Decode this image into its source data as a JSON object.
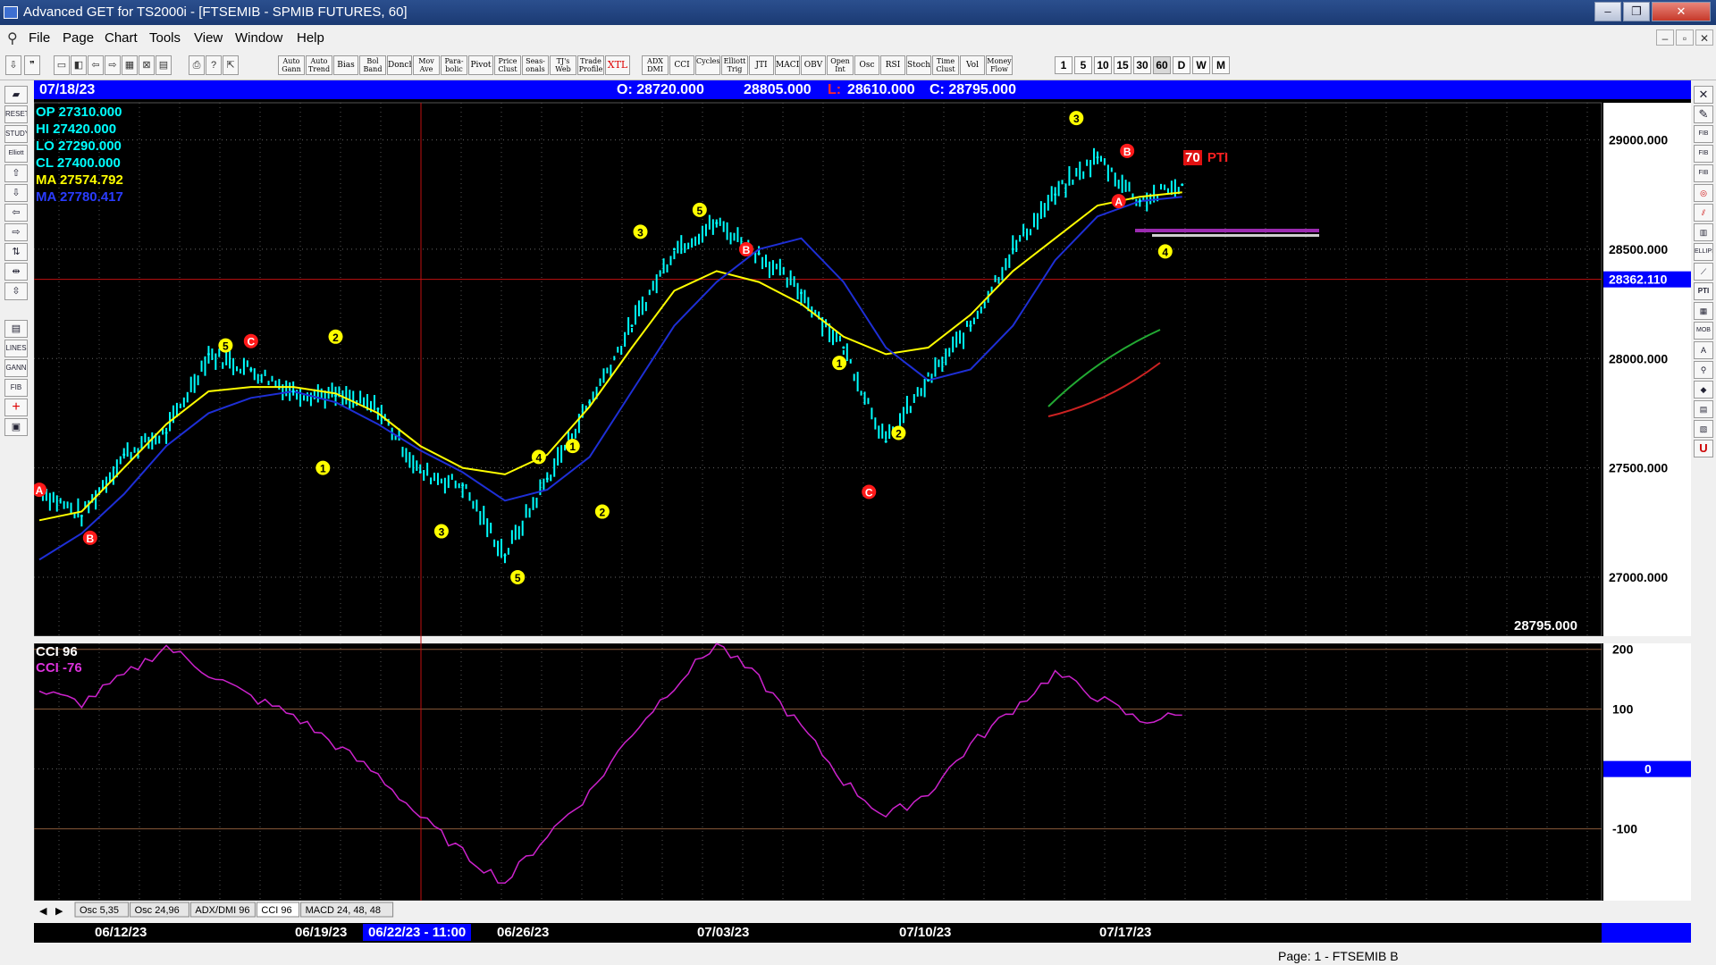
{
  "window": {
    "title": "Advanced GET for TS2000i - [FTSEMIB - SPMIB FUTURES, 60]",
    "controls": [
      "‒",
      "❐",
      "✕"
    ]
  },
  "menu": [
    "File",
    "Page",
    "Chart",
    "Tools",
    "View",
    "Window",
    "Help"
  ],
  "mdi_controls": [
    "‒",
    "▫",
    "✕"
  ],
  "toolbar": {
    "studies": [
      "Auto Gann",
      "Auto Trend",
      "Bias",
      "Bol Band",
      "Donch",
      "Mov Ave",
      "Para-bolic",
      "Pivot",
      "Price Clust",
      "Seas-onals",
      "TJ's Web",
      "Trade Profile",
      "XTL",
      "ADX DMI",
      "CCI",
      "Cycles",
      "Elliott Trig",
      "JTI",
      "MACD",
      "OBV",
      "Open Int",
      "Osc",
      "RSI",
      "Stoch",
      "Time Clust",
      "Vol",
      "Money Flow"
    ],
    "timeframes": [
      "1",
      "5",
      "10",
      "15",
      "30",
      "60",
      "D",
      "W",
      "M"
    ],
    "active_timeframe": "60"
  },
  "left_toolbar": [
    "RESET",
    "STUDY",
    "Elliott",
    "LINES",
    "GANN",
    "FIB"
  ],
  "right_toolbar": [
    "FIB RET",
    "FIB EXT",
    "FIB TIME",
    "ELLIPS",
    "PTI",
    "MOB"
  ],
  "infobar": {
    "date": "07/18/23",
    "open": "O: 28720.000",
    "high": "28805.000",
    "low_label": "L:",
    "low": "28610.000",
    "close": "C: 28795.000"
  },
  "readout": {
    "op": "OP  27310.000",
    "hi": "HI   27420.000",
    "lo": "LO  27290.000",
    "cl": "CL  27400.000",
    "ma1": "MA  27574.792",
    "ma2": "MA  27780.417"
  },
  "price_axis": {
    "ticks": [
      "29000.000",
      "28500.000",
      "28000.000",
      "27500.000",
      "27000.000"
    ],
    "tick_values": [
      29000,
      28500,
      28000,
      27500,
      27000
    ],
    "cursor_price": "28362.110",
    "last_price": "28795.000",
    "range": [
      26730,
      29170
    ]
  },
  "cci_panel": {
    "label1": "CCI 96",
    "label2": "CCI  -76",
    "ticks": [
      "200",
      "100",
      "0",
      "-100"
    ],
    "tick_values": [
      200,
      100,
      0,
      -100
    ],
    "highlight": "0",
    "range": [
      -220,
      210
    ]
  },
  "pti": {
    "value": "70",
    "label": "PTI"
  },
  "tabs": [
    "Osc 5,35",
    "Osc 24,96",
    "ADX/DMI 96",
    "CCI 96",
    "MACD 24, 48, 48"
  ],
  "active_tab": "CCI 96",
  "date_axis": {
    "labels": [
      "06/12/23",
      "06/19/23",
      "06/26/23",
      "07/03/23",
      "07/10/23",
      "07/17/23"
    ],
    "cursor_date": "06/22/23 - 11:00"
  },
  "status": {
    "page": "Page: 1 - FTSEMIB B"
  },
  "colors": {
    "ma_fast": "#ffff00",
    "ma_slow": "#1e2fd6",
    "price_bars": "#00ffff",
    "cci": "#cc22cc",
    "wave_yellow": "#ffff00",
    "wave_red": "#ff1a1a",
    "infobar": "#0000ff"
  },
  "chart_data": {
    "type": "line",
    "x": [
      "06/09/23",
      "06/12/23",
      "06/13/23",
      "06/14/23",
      "06/15/23",
      "06/16/23",
      "06/19/23",
      "06/20/23",
      "06/21/23",
      "06/22/23",
      "06/23/23",
      "06/26/23",
      "06/27/23",
      "06/28/23",
      "06/29/23",
      "06/30/23",
      "07/03/23",
      "07/04/23",
      "07/05/23",
      "07/06/23",
      "07/07/23",
      "07/10/23",
      "07/11/23",
      "07/12/23",
      "07/13/23",
      "07/14/23",
      "07/17/23",
      "07/18/23"
    ],
    "series": [
      {
        "values": [
          27400,
          27280,
          27560,
          27660,
          28020,
          27950,
          27850,
          27830,
          27770,
          27480,
          27420,
          27100,
          27450,
          27800,
          28150,
          28500,
          28620,
          28480,
          28300,
          28050,
          27620,
          27900,
          28150,
          28500,
          28750,
          28920,
          28720,
          28795
        ]
      },
      {
        "values": [
          27260,
          27300,
          27500,
          27700,
          27850,
          27870,
          27870,
          27840,
          27750,
          27600,
          27500,
          27470,
          27560,
          27780,
          28050,
          28310,
          28400,
          28350,
          28250,
          28100,
          28020,
          28050,
          28200,
          28400,
          28550,
          28700,
          28740,
          28760
        ]
      },
      {
        "values": [
          27080,
          27200,
          27380,
          27600,
          27750,
          27820,
          27850,
          27800,
          27700,
          27580,
          27480,
          27350,
          27400,
          27550,
          27850,
          28150,
          28350,
          28500,
          28550,
          28350,
          28050,
          27900,
          27950,
          28150,
          28450,
          28650,
          28720,
          28740
        ]
      }
    ],
    "cci": [
      130,
      110,
      155,
      205,
      160,
      120,
      90,
      40,
      -10,
      -80,
      -140,
      -190,
      -110,
      -40,
      60,
      140,
      210,
      150,
      70,
      -20,
      -80,
      -40,
      40,
      100,
      160,
      120,
      80,
      90
    ]
  }
}
